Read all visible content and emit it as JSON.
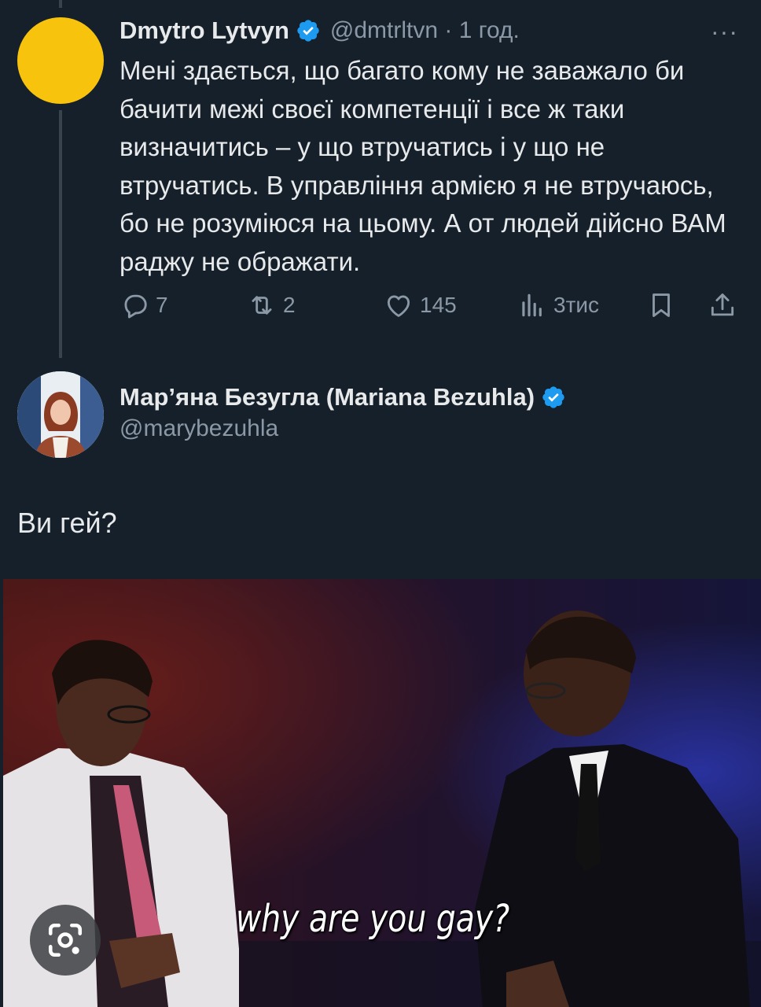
{
  "tweet1": {
    "author_name": "Dmytro Lytvyn",
    "handle_time": "@dmtrltvn · 1 год.",
    "text": "Мені здається, що багато кому не заважало би бачити межі своєї компетенції і все ж таки визначитись – у що втручатись і у що не втручатись. В управління армією я не втручаюсь, бо не розуміюся на цьому. А от людей дійсно ВАМ раджу не ображати.",
    "more_glyph": "···",
    "actions": {
      "replies": "7",
      "retweets": "2",
      "likes": "145",
      "views": "3тис"
    },
    "avatar_color": "#f7c30d"
  },
  "tweet2": {
    "author_name": "Мар’яна Безугла (Mariana Bezuhla)",
    "handle": "@marybezuhla",
    "text": "Ви гей?"
  },
  "meme": {
    "subtitle": "why are you gay?",
    "lens_icon": "camera-lens-icon"
  },
  "colors": {
    "background": "#15202b",
    "verified": "#1d9bf0",
    "secondary_text": "#8b98a5",
    "thread_line": "#38444d"
  }
}
